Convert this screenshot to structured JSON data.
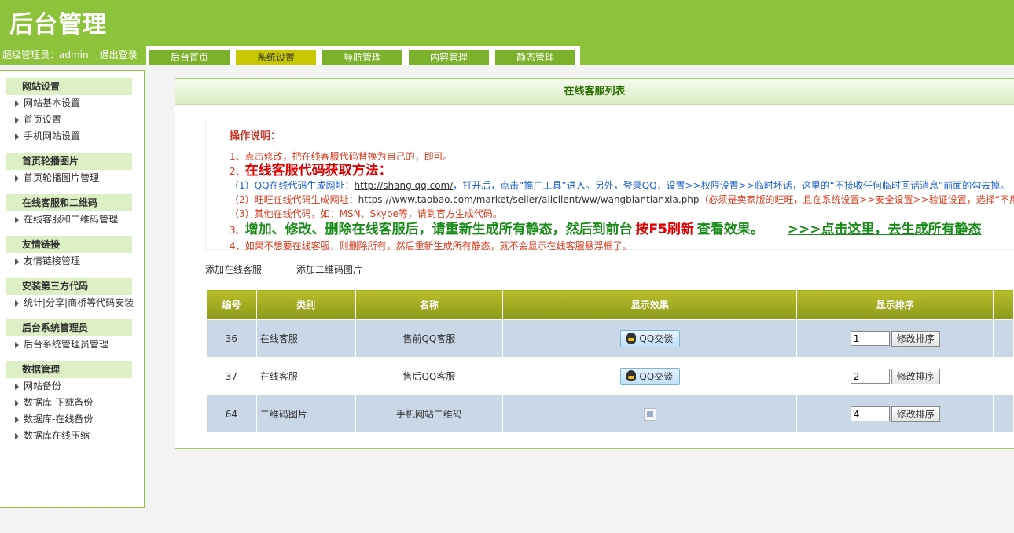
{
  "header": {
    "logo": "后台管理",
    "user_label": "超级管理员：admin",
    "logout": "退出登录"
  },
  "tabs": [
    "后台首页",
    "系统设置",
    "导航管理",
    "内容管理",
    "静态管理"
  ],
  "active_tab": "系统设置",
  "sidebar": {
    "groups": [
      {
        "title": "网站设置",
        "items": [
          "网站基本设置",
          "首页设置",
          "手机网站设置"
        ]
      },
      {
        "title": "首页轮播图片",
        "items": [
          "首页轮播图片管理"
        ]
      },
      {
        "title": "在线客服和二维码",
        "items": [
          "在线客服和二维码管理"
        ]
      },
      {
        "title": "友情链接",
        "items": [
          "友情链接管理"
        ]
      },
      {
        "title": "安装第三方代码",
        "items": [
          "统计|分享|商桥等代码安装"
        ]
      },
      {
        "title": "后台系统管理员",
        "items": [
          "后台系统管理员管理"
        ]
      },
      {
        "title": "数据管理",
        "items": [
          "网站备份",
          "数据库-下载备份",
          "数据库-在线备份",
          "数据库在线压缩"
        ]
      }
    ]
  },
  "main": {
    "title": "在线客服列表",
    "notes": {
      "head": "操作说明：",
      "l1": "1、点击修改，把在线客服代码替换为自己的，即可。",
      "l2_prefix": "2、",
      "l2_big": "在线客服代码获取方法：",
      "l3_a": "（1）QQ在线代码生成网址：",
      "l3_link": "http://shang.qq.com/",
      "l3_b": "，打开后，点击“推广工具”进入。另外，登录QQ，设置>>权限设置>>临时坏话，这里的“不接收任何临时回话消息”前面的勾去掉。",
      "l4_a": "（2）旺旺在线代码生成网址：",
      "l4_link": "https://www.taobao.com/market/seller/aliclient/ww/wangbiantianxia.php",
      "l4_b": "（必须是卖家版的旺旺，且在系统设置>>安全设置>>验证设置，选择“不用我验证”）",
      "l5": "（3）其他在线代码，如：MSN、Skype等，请到官方生成代码。",
      "l6_prefix": "3、",
      "l6_a": "增加、修改、删除在线客服后，请重新生成所有静态，然后到前台",
      "l6_b": "按F5刷新",
      "l6_c": "查看效果。",
      "l6_link": ">>>点击这里，去生成所有静态",
      "l7": "4、如果不想要在线客服，则删除所有，然后重新生成所有静态，就不会显示在线客服悬浮框了。"
    },
    "links": [
      "添加在线客服",
      "添加二维码图片"
    ],
    "table": {
      "headers": [
        "编号",
        "类别",
        "名称",
        "显示效果",
        "显示排序",
        ""
      ],
      "rows": [
        {
          "id": "36",
          "type": "在线客服",
          "name": "售前QQ客服",
          "effect": "QQ交谈",
          "sort": "1",
          "btn": "修改排序"
        },
        {
          "id": "37",
          "type": "在线客服",
          "name": "售后QQ客服",
          "effect": "QQ交谈",
          "sort": "2",
          "btn": "修改排序"
        },
        {
          "id": "64",
          "type": "二维码图片",
          "name": "手机网站二维码",
          "effect": "",
          "sort": "4",
          "btn": "修改排序"
        }
      ]
    }
  }
}
